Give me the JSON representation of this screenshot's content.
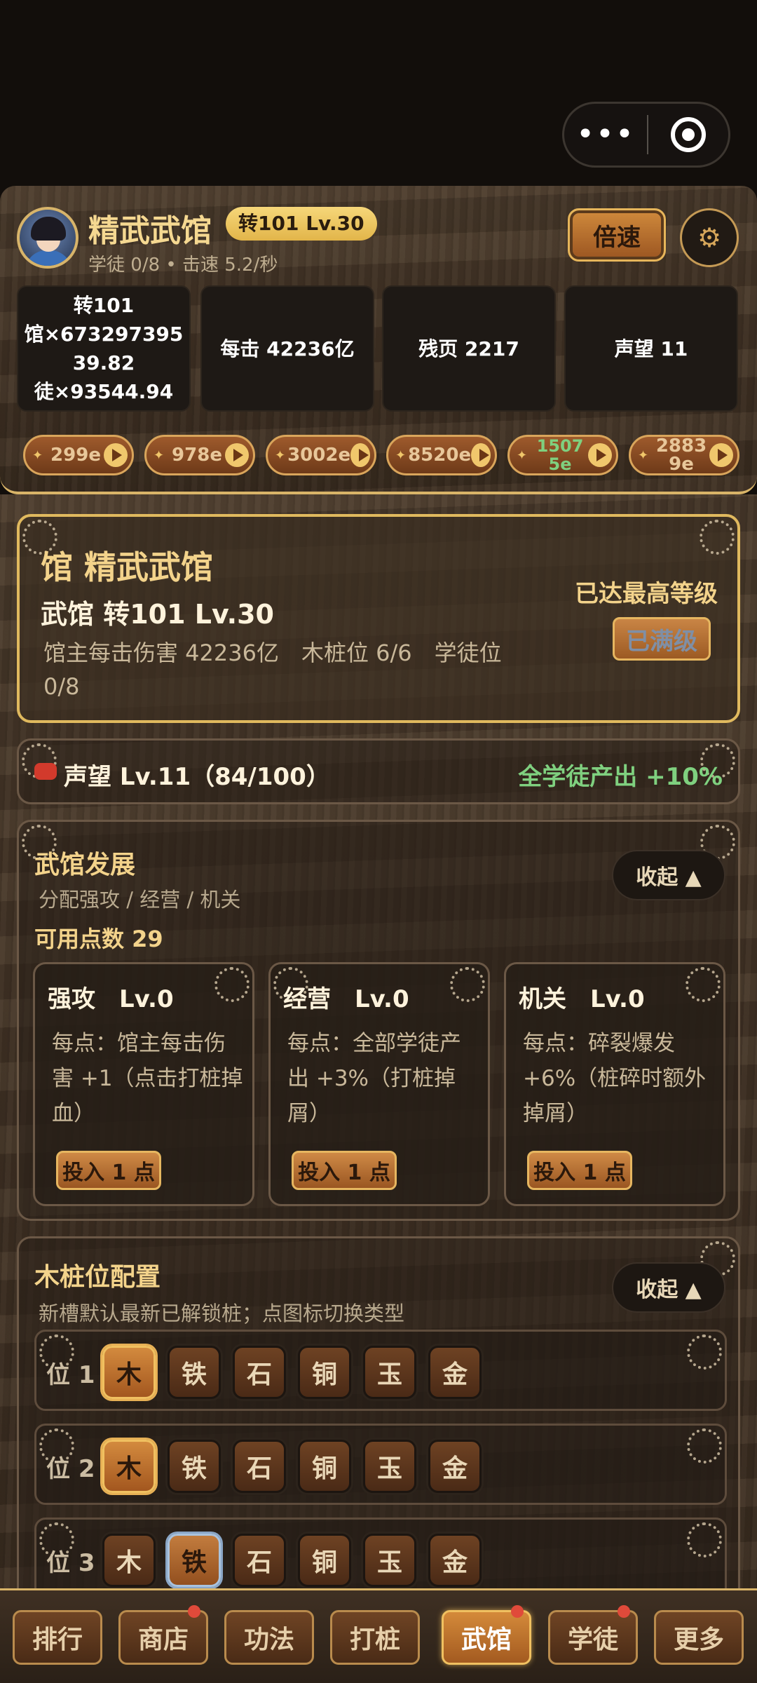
{
  "capsule": {
    "menu_glyph": "•••",
    "close_label": ""
  },
  "header": {
    "gym_name": "精武武馆",
    "level_badge": "转101 Lv.30",
    "sub_info": "学徒 0/8 • 击速 5.2/秒",
    "speed_label": "倍速",
    "settings_glyph": "⚙",
    "stats": [
      {
        "lines": [
          "转101",
          "馆×673297395",
          "39.82",
          "徒×93544.94"
        ]
      },
      {
        "lines": [
          "每击 42236亿"
        ]
      },
      {
        "lines": [
          "残页 2217"
        ]
      },
      {
        "lines": [
          "声望 11"
        ]
      }
    ],
    "resources": [
      {
        "icon": "✦",
        "value": "299e"
      },
      {
        "icon": "✦",
        "value": "978e"
      },
      {
        "icon": "✦",
        "value": "3002e"
      },
      {
        "icon": "✦",
        "value": "8520e"
      },
      {
        "icon": "✦",
        "value_line1": "1507",
        "value_line2": "5e",
        "color": "#7fd07f"
      },
      {
        "icon": "✦",
        "value_line1": "2883",
        "value_line2": "9e",
        "color": "#e8c79a"
      }
    ]
  },
  "info_card": {
    "title": "馆 精武武馆",
    "level": "武馆 转101 Lv.30",
    "desc": "馆主每击伤害 42236亿　木桩位 6/6　学徒位 0/8",
    "max_label": "已达最高等级",
    "maxed_button": "已满级"
  },
  "reputation": {
    "text": "声望 Lv.11（84/100）",
    "bonus": "全学徒产出 +10%"
  },
  "development": {
    "title": "武馆发展",
    "subtitle": "分配强攻 / 经营 / 机关",
    "points": "可用点数 29",
    "collapse_label": "收起 ▲",
    "upgrades": [
      {
        "name": "强攻　Lv.0",
        "desc": "每点：馆主每击伤害 +1（点击打桩掉血）",
        "button": "投入 1 点"
      },
      {
        "name": "经营　Lv.0",
        "desc": "每点：全部学徒产出 +3%（打桩掉屑）",
        "button": "投入 1 点"
      },
      {
        "name": "机关　Lv.0",
        "desc": "每点：碎裂爆发 +6%（桩碎时额外掉屑）",
        "button": "投入 1 点"
      }
    ]
  },
  "slots": {
    "title": "木桩位配置",
    "subtitle": "新槽默认最新已解锁桩；点图标切换类型",
    "collapse_label": "收起 ▲",
    "types": [
      "木",
      "铁",
      "石",
      "铜",
      "玉",
      "金"
    ],
    "rows": [
      {
        "label": "位 1",
        "selected": 0,
        "style": "gold"
      },
      {
        "label": "位 2",
        "selected": 0,
        "style": "gold"
      },
      {
        "label": "位 3",
        "selected": 1,
        "style": "blue"
      }
    ]
  },
  "bottom_nav": {
    "items": [
      {
        "label": "排行",
        "badge": false,
        "active": false
      },
      {
        "label": "商店",
        "badge": true,
        "active": false
      },
      {
        "label": "功法",
        "badge": false,
        "active": false
      },
      {
        "label": "打桩",
        "badge": false,
        "active": false
      },
      {
        "label": "武馆",
        "badge": true,
        "active": true
      },
      {
        "label": "学徒",
        "badge": true,
        "active": false
      },
      {
        "label": "更多",
        "badge": false,
        "active": false
      }
    ]
  },
  "colors": {
    "gold": "#f3d38b",
    "green": "#7fd07f",
    "accent_border": "#e0b95e",
    "badge_red": "#e04a3a"
  }
}
